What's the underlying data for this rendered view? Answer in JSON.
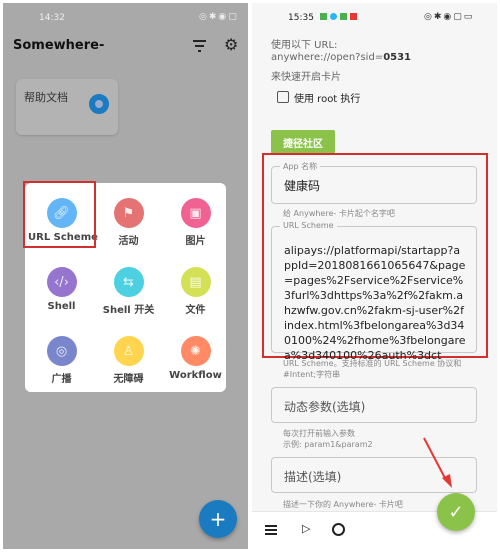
{
  "left": {
    "status_time": "14:32",
    "app_title": "Somewhere-",
    "card": {
      "label": "帮助文档"
    },
    "menu": [
      {
        "label": "URL Scheme",
        "icon": "link-icon",
        "color": "#64b5f6"
      },
      {
        "label": "活动",
        "icon": "flag-icon",
        "color": "#e57373"
      },
      {
        "label": "图片",
        "icon": "image-icon",
        "color": "#f06292"
      },
      {
        "label": "Shell",
        "icon": "code-icon",
        "color": "#9575cd"
      },
      {
        "label": "Shell 开关",
        "icon": "switch-icon",
        "color": "#4dd0e1"
      },
      {
        "label": "文件",
        "icon": "file-icon",
        "color": "#d4e157"
      },
      {
        "label": "广播",
        "icon": "broadcast-icon",
        "color": "#7986cb"
      },
      {
        "label": "无障碍",
        "icon": "accessibility-icon",
        "color": "#ffd54f"
      },
      {
        "label": "Workflow",
        "icon": "workflow-icon",
        "color": "#ff8a65"
      }
    ],
    "fab_label": "+",
    "fab_color": "#1a7bc0"
  },
  "right": {
    "status_time": "15:35",
    "info_line1": "使用以下 URL:",
    "info_url_prefix": "anywhere://open?sid=",
    "info_url_sid": "0531",
    "info_line3": "来快速开启卡片",
    "root_checkbox": {
      "label": "使用 root 执行",
      "checked": false
    },
    "community_button": "捷径社区",
    "accent": "#8bc34a",
    "app_name": {
      "label": "App 名称",
      "value": "健康码",
      "helper": "给 Anywhere- 卡片起个名字吧"
    },
    "url_scheme": {
      "label": "URL Scheme",
      "value": "alipays://platformapi/startapp?appId=20180816610656​47&page=pages%2Fservice%2Fservice%3furl%3dhttps%3a%2f%2fakm.ahzwfw.gov.cn%2fakm-sj-user%2findex.html%3fbelongarea%3d340100%24%2fhome%3fbelongarea%3d340100%26auth%3dct",
      "helper1": "URL Scheme。支持标准的 URL Scheme 协议和",
      "helper2": "#Intent;字符串"
    },
    "dynamic_params": {
      "placeholder": "动态参数(选填)",
      "helper1": "每次打开前输入参数",
      "helper2": "示例: param1&param2"
    },
    "description": {
      "placeholder": "描述(选填)",
      "helper": "描述一下你的 Anywhere- 卡片吧"
    },
    "fab_label": "✓"
  }
}
